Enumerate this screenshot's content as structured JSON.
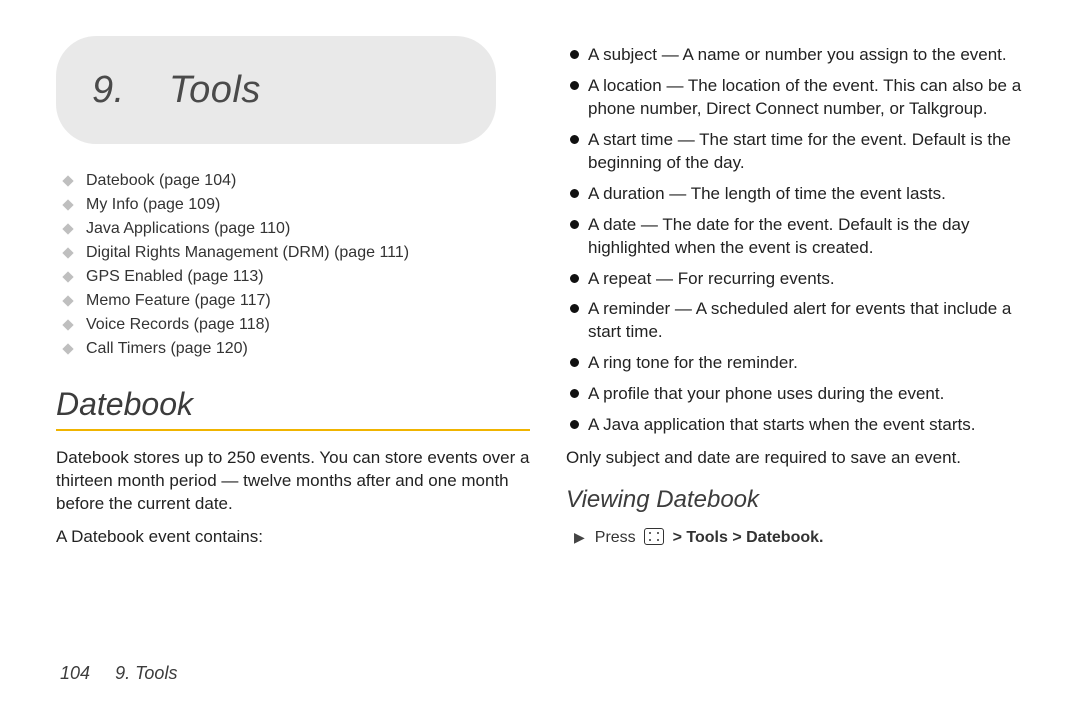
{
  "header": {
    "chapter_number": "9.",
    "chapter_title": "Tools"
  },
  "toc": [
    "Datebook (page 104)",
    "My Info (page 109)",
    "Java Applications (page 110)",
    "Digital Rights Management (DRM) (page 111)",
    "GPS Enabled (page 113)",
    "Memo Feature (page 117)",
    "Voice Records (page 118)",
    "Call Timers (page 120)"
  ],
  "section": {
    "title": "Datebook",
    "para1": "Datebook stores up to 250 events. You can store events over a thirteen month period — twelve months after and one month before the current date.",
    "para2": "A Datebook event contains:"
  },
  "bullets": [
    "A subject — A name or number you assign to the event.",
    "A location — The location of the event. This can also be a phone number, Direct Connect number, or Talkgroup.",
    "A start time — The start time for the event. Default is the beginning of the day.",
    "A duration — The length of time the event lasts.",
    "A date — The date for the event. Default is the day highlighted when the event is created.",
    "A repeat — For recurring events.",
    "A reminder — A scheduled alert for events that include a start time.",
    "A ring tone for the reminder.",
    "A profile that your phone uses during the event.",
    "A Java application that starts when the event starts."
  ],
  "after_bullets": "Only subject and date are required to save an event.",
  "subheading": "Viewing Datebook",
  "instruction": {
    "lead": "Press",
    "gt1": ">",
    "path1": "Tools",
    "gt2": ">",
    "path2": "Datebook",
    "dot": "."
  },
  "footer": {
    "page_number": "104",
    "running_head": "9. Tools"
  }
}
